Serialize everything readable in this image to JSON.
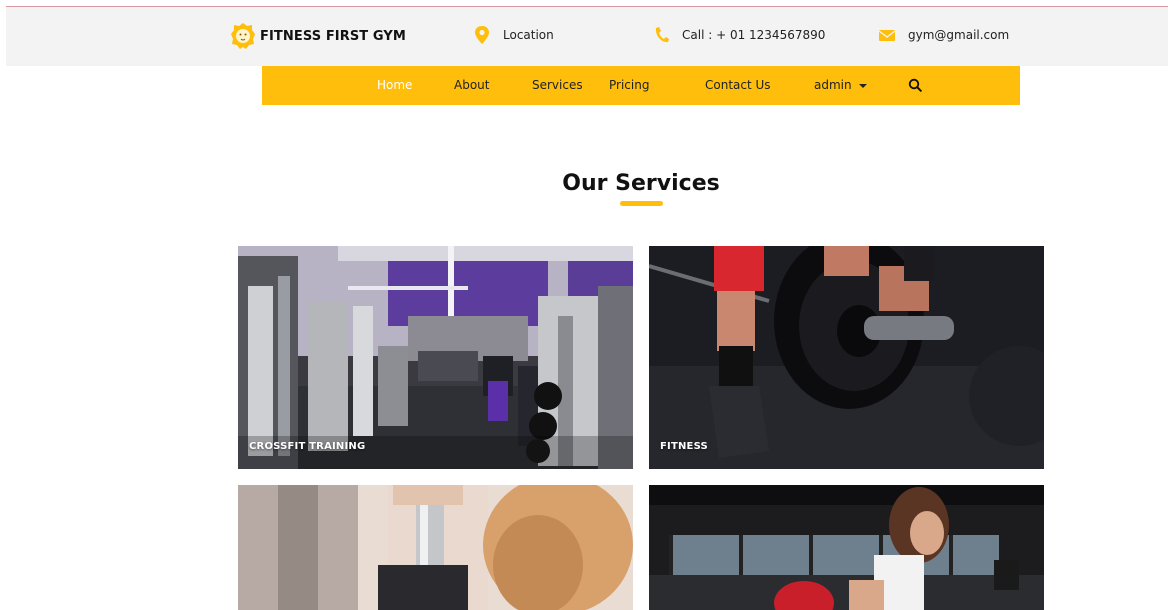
{
  "header": {
    "brand": "FITNESS FIRST GYM",
    "location": "Location",
    "phone": "Call : + 01 1234567890",
    "email": "gym@gmail.com"
  },
  "nav": {
    "items": [
      {
        "label": "Home",
        "active": true
      },
      {
        "label": "About"
      },
      {
        "label": "Services"
      },
      {
        "label": "Pricing"
      },
      {
        "label": "Contact Us"
      },
      {
        "label": "admin"
      }
    ]
  },
  "services": {
    "title": "Our Services",
    "cards": [
      {
        "label": "CROSSFIT TRAINING",
        "image": "gym-interior-photo"
      },
      {
        "label": "FITNESS",
        "image": "barbell-plate-photo"
      },
      {
        "label": "",
        "image": "dumbbell-woman-photo"
      },
      {
        "label": "",
        "image": "woman-exercise-photo"
      }
    ]
  },
  "colors": {
    "accent": "#ffbe0b",
    "topbar": "#f3f3f3"
  }
}
